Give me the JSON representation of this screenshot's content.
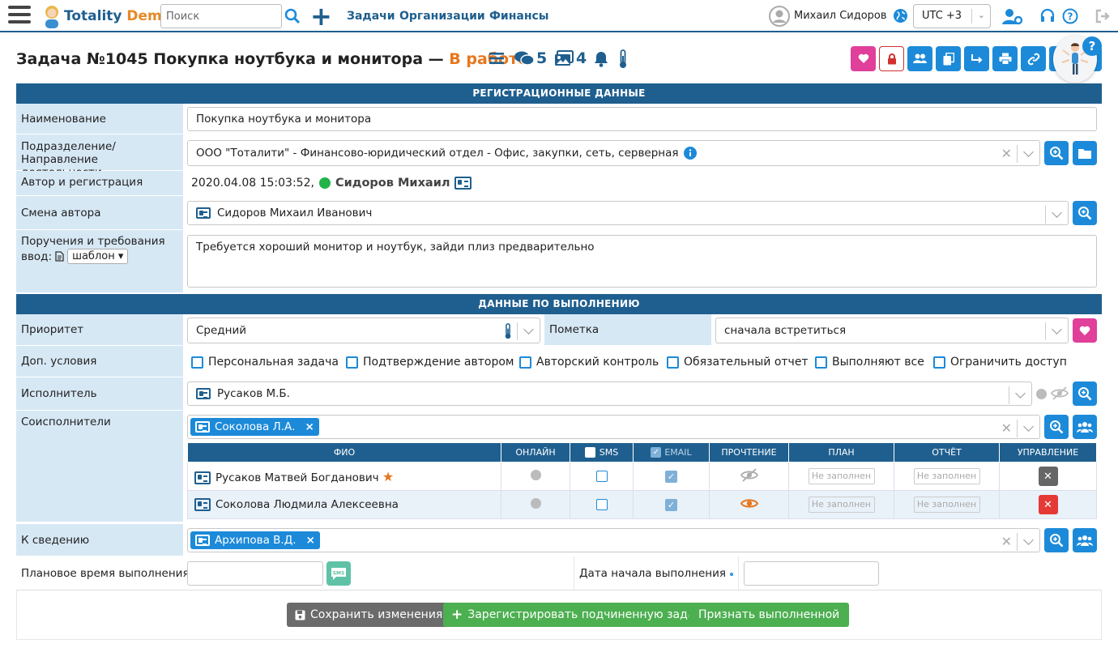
{
  "topbar": {
    "logo_main": "Totality",
    "logo_accent": " Demo",
    "search_placeholder": "Поиск",
    "nav": [
      "Задачи",
      "Организации",
      "Финансы"
    ],
    "user": "Михаил Сидоров",
    "timezone": "UTC +3"
  },
  "task": {
    "title": "Задача №1045 Покупка ноутбука и монитора — ",
    "status": "В работе",
    "comments_count": "5",
    "images_count": "4"
  },
  "sections": {
    "registration": "РЕГИСТРАЦИОННЫЕ ДАННЫЕ",
    "execution": "ДАННЫЕ ПО ВЫПОЛНЕНИЮ"
  },
  "labels": {
    "name": "Наименование",
    "dept": "Подразделение/ Направление деятельности",
    "author_reg": "Автор и регистрация",
    "change_author": "Смена автора",
    "instructions": "Поручения и требования",
    "input": "ввод:",
    "template": "шаблон",
    "priority": "Приоритет",
    "mark": "Пометка",
    "extra": "Доп. условия",
    "executor": "Исполнитель",
    "coexecutors": "Соисполнители",
    "info": "К сведению",
    "planned_time": "Плановое время выполнения",
    "start_date": "Дата начала выполнения"
  },
  "fields": {
    "name": "Покупка ноутбука и монитора",
    "dept": "ООО \"Тоталити\" - Финансово-юридический отдел - Офис, закупки, сеть, серверная",
    "reg_date": "2020.04.08 15:03:52,",
    "author": "Сидоров Михаил",
    "change_author": "Сидоров Михаил Иванович",
    "instructions": "Требуется хороший монитор и ноутбук, зайди плиз предварительно",
    "priority": "Средний",
    "mark": "сначала встретиться",
    "executor": "Русаков М.Б.",
    "coexecutor_chip": "Соколова Л.А.",
    "info_chip": "Архипова В.Д.",
    "planned_time": "",
    "start_date": ""
  },
  "checkboxes": [
    "Персональная задача",
    "Подтверждение автором",
    "Авторский контроль",
    "Обязательный отчет",
    "Выполняют все",
    "Ограничить доступ"
  ],
  "table": {
    "headers": {
      "fio": "ФИО",
      "online": "ОНЛАЙН",
      "sms": "SMS",
      "email": "EMAIL",
      "read": "ПРОЧТЕНИЕ",
      "plan": "ПЛАН",
      "report": "ОТЧЁТ",
      "manage": "УПРАВЛЕНИЕ"
    },
    "rows": [
      {
        "fio": "Русаков Матвей Богданович",
        "plan": "Не заполнен",
        "report": "Не заполнен"
      },
      {
        "fio": "Соколова Людмила Алексеевна",
        "plan": "Не заполнен",
        "report": "Не заполнен"
      }
    ]
  },
  "buttons": {
    "save": "Сохранить изменения",
    "sub_task": "Зарегистрировать подчиненную задачу",
    "complete": "Признать выполненной"
  },
  "colors": {
    "primary": "#1f5f8f",
    "accent": "#1c8ad9",
    "status": "#e8761c",
    "pink": "#e03f9a",
    "green": "#4caf50",
    "gray_btn": "#6b6b6b",
    "danger": "#e53935"
  }
}
